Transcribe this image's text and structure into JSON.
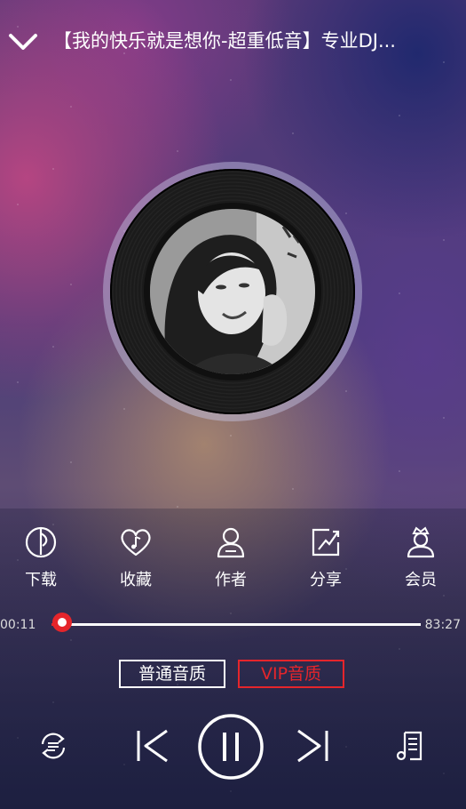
{
  "header": {
    "title": "【我的快乐就是想你-超重低音】专业DJ..."
  },
  "actions": [
    {
      "label": "下载",
      "icon": "download-icon"
    },
    {
      "label": "收藏",
      "icon": "heart-music-icon"
    },
    {
      "label": "作者",
      "icon": "user-icon"
    },
    {
      "label": "分享",
      "icon": "share-icon"
    },
    {
      "label": "会员",
      "icon": "vip-member-icon"
    }
  ],
  "progress": {
    "elapsed": "00:11",
    "total": "83:27",
    "fraction": 0.002
  },
  "quality": {
    "standard_label": "普通音质",
    "vip_label": "VIP音质"
  },
  "controls": {
    "state": "playing",
    "icons": [
      "repeat-mode-icon",
      "previous-icon",
      "pause-icon",
      "next-icon",
      "playlist-icon"
    ]
  },
  "colors": {
    "accent": "#e5252b",
    "text": "#ffffff"
  }
}
